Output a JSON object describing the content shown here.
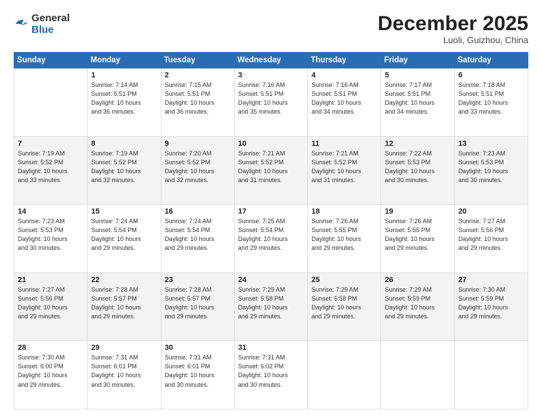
{
  "header": {
    "logo_general": "General",
    "logo_blue": "Blue",
    "month_year": "December 2025",
    "location": "Luoli, Guizhou, China"
  },
  "weekdays": [
    "Sunday",
    "Monday",
    "Tuesday",
    "Wednesday",
    "Thursday",
    "Friday",
    "Saturday"
  ],
  "weeks": [
    [
      {
        "day": "",
        "info": ""
      },
      {
        "day": "1",
        "info": "Sunrise: 7:14 AM\nSunset: 5:51 PM\nDaylight: 10 hours\nand 36 minutes."
      },
      {
        "day": "2",
        "info": "Sunrise: 7:15 AM\nSunset: 5:51 PM\nDaylight: 10 hours\nand 36 minutes."
      },
      {
        "day": "3",
        "info": "Sunrise: 7:16 AM\nSunset: 5:51 PM\nDaylight: 10 hours\nand 35 minutes."
      },
      {
        "day": "4",
        "info": "Sunrise: 7:16 AM\nSunset: 5:51 PM\nDaylight: 10 hours\nand 34 minutes."
      },
      {
        "day": "5",
        "info": "Sunrise: 7:17 AM\nSunset: 5:51 PM\nDaylight: 10 hours\nand 34 minutes."
      },
      {
        "day": "6",
        "info": "Sunrise: 7:18 AM\nSunset: 5:51 PM\nDaylight: 10 hours\nand 33 minutes."
      }
    ],
    [
      {
        "day": "7",
        "info": "Sunrise: 7:19 AM\nSunset: 5:52 PM\nDaylight: 10 hours\nand 33 minutes."
      },
      {
        "day": "8",
        "info": "Sunrise: 7:19 AM\nSunset: 5:52 PM\nDaylight: 10 hours\nand 32 minutes."
      },
      {
        "day": "9",
        "info": "Sunrise: 7:20 AM\nSunset: 5:52 PM\nDaylight: 10 hours\nand 32 minutes."
      },
      {
        "day": "10",
        "info": "Sunrise: 7:21 AM\nSunset: 5:52 PM\nDaylight: 10 hours\nand 31 minutes."
      },
      {
        "day": "11",
        "info": "Sunrise: 7:21 AM\nSunset: 5:52 PM\nDaylight: 10 hours\nand 31 minutes."
      },
      {
        "day": "12",
        "info": "Sunrise: 7:22 AM\nSunset: 5:53 PM\nDaylight: 10 hours\nand 30 minutes."
      },
      {
        "day": "13",
        "info": "Sunrise: 7:23 AM\nSunset: 5:53 PM\nDaylight: 10 hours\nand 30 minutes."
      }
    ],
    [
      {
        "day": "14",
        "info": "Sunrise: 7:23 AM\nSunset: 5:53 PM\nDaylight: 10 hours\nand 30 minutes."
      },
      {
        "day": "15",
        "info": "Sunrise: 7:24 AM\nSunset: 5:54 PM\nDaylight: 10 hours\nand 29 minutes."
      },
      {
        "day": "16",
        "info": "Sunrise: 7:24 AM\nSunset: 5:54 PM\nDaylight: 10 hours\nand 29 minutes."
      },
      {
        "day": "17",
        "info": "Sunrise: 7:25 AM\nSunset: 5:54 PM\nDaylight: 10 hours\nand 29 minutes."
      },
      {
        "day": "18",
        "info": "Sunrise: 7:26 AM\nSunset: 5:55 PM\nDaylight: 10 hours\nand 29 minutes."
      },
      {
        "day": "19",
        "info": "Sunrise: 7:26 AM\nSunset: 5:55 PM\nDaylight: 10 hours\nand 29 minutes."
      },
      {
        "day": "20",
        "info": "Sunrise: 7:27 AM\nSunset: 5:56 PM\nDaylight: 10 hours\nand 29 minutes."
      }
    ],
    [
      {
        "day": "21",
        "info": "Sunrise: 7:27 AM\nSunset: 5:56 PM\nDaylight: 10 hours\nand 29 minutes."
      },
      {
        "day": "22",
        "info": "Sunrise: 7:28 AM\nSunset: 5:57 PM\nDaylight: 10 hours\nand 29 minutes."
      },
      {
        "day": "23",
        "info": "Sunrise: 7:28 AM\nSunset: 5:57 PM\nDaylight: 10 hours\nand 29 minutes."
      },
      {
        "day": "24",
        "info": "Sunrise: 7:29 AM\nSunset: 5:58 PM\nDaylight: 10 hours\nand 29 minutes."
      },
      {
        "day": "25",
        "info": "Sunrise: 7:29 AM\nSunset: 5:58 PM\nDaylight: 10 hours\nand 29 minutes."
      },
      {
        "day": "26",
        "info": "Sunrise: 7:29 AM\nSunset: 5:59 PM\nDaylight: 10 hours\nand 29 minutes."
      },
      {
        "day": "27",
        "info": "Sunrise: 7:30 AM\nSunset: 5:59 PM\nDaylight: 10 hours\nand 29 minutes."
      }
    ],
    [
      {
        "day": "28",
        "info": "Sunrise: 7:30 AM\nSunset: 6:00 PM\nDaylight: 10 hours\nand 29 minutes."
      },
      {
        "day": "29",
        "info": "Sunrise: 7:31 AM\nSunset: 6:01 PM\nDaylight: 10 hours\nand 30 minutes."
      },
      {
        "day": "30",
        "info": "Sunrise: 7:31 AM\nSunset: 6:01 PM\nDaylight: 10 hours\nand 30 minutes."
      },
      {
        "day": "31",
        "info": "Sunrise: 7:31 AM\nSunset: 6:02 PM\nDaylight: 10 hours\nand 30 minutes."
      },
      {
        "day": "",
        "info": ""
      },
      {
        "day": "",
        "info": ""
      },
      {
        "day": "",
        "info": ""
      }
    ]
  ]
}
